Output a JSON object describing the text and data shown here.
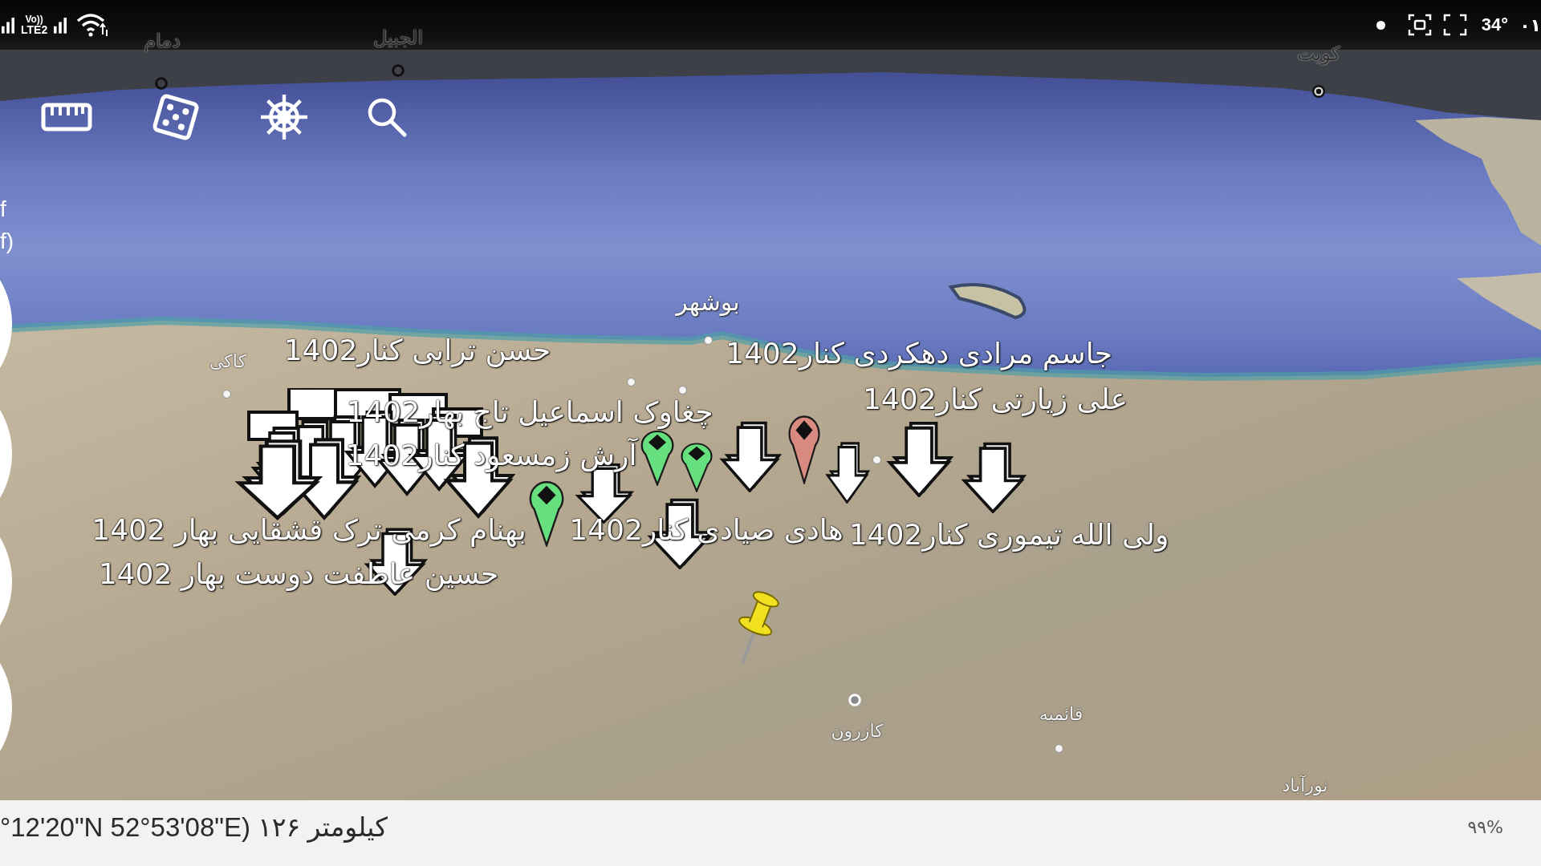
{
  "status_bar": {
    "volte": "Vo))",
    "network": "LTE2",
    "temperature": "34°",
    "clock": "۰۱"
  },
  "side_texts": [
    "f",
    "f)"
  ],
  "map": {
    "place_names": [
      {
        "label": "کویت",
        "kind": "faded"
      },
      {
        "label": "الجبیل",
        "kind": "faded"
      },
      {
        "label": "دمام",
        "kind": "faded"
      },
      {
        "label": "بوشهر",
        "kind": "city"
      },
      {
        "label": "کاکی",
        "kind": "town"
      },
      {
        "label": "قائمیه",
        "kind": "town"
      },
      {
        "label": "کازرون",
        "kind": "town"
      },
      {
        "label": "نورآباد",
        "kind": "town"
      }
    ],
    "placemarks": [
      {
        "kind": "arrow_stack"
      },
      {
        "kind": "arrow"
      },
      {
        "kind": "balloon",
        "color": "#66e07e"
      },
      {
        "kind": "arrow"
      },
      {
        "kind": "balloon",
        "color": "#66e07e"
      },
      {
        "kind": "balloon",
        "color": "#66e07e"
      },
      {
        "kind": "arrow"
      },
      {
        "kind": "arrow"
      },
      {
        "kind": "balloon",
        "color": "#d98a80"
      },
      {
        "kind": "arrow"
      },
      {
        "kind": "arrow"
      },
      {
        "kind": "arrow"
      },
      {
        "kind": "pushpin",
        "color": "#f0e020"
      }
    ],
    "placemark_labels": [
      "جاسم مرادی دهکردی کنار1402",
      "حسن ترابی کنار1402",
      "علی زیارتی کنار1402",
      "چغاوک اسماعیل تاج بهار1402",
      "آرش زمسعود کنار1402",
      "ولی الله تیموری کنار1402",
      "هادی صیادی کنار1402",
      "بهنام کرمی ترک قشقایی بهار 1402",
      "حسین عاطفت دوست بهار 1402"
    ]
  },
  "bottom_bar": {
    "coordinates": "°12'20\"N 52°53'08\"E) کیلومتر ۱۲۶",
    "progress": "۹۹%"
  }
}
